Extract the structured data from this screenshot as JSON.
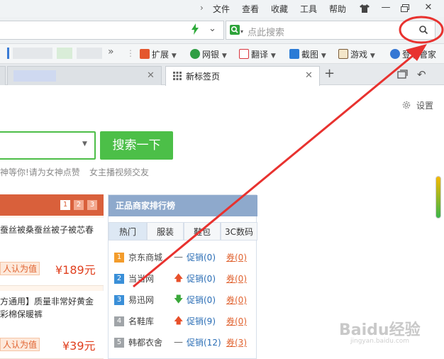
{
  "menu": {
    "items": [
      "文件",
      "查看",
      "收藏",
      "工具",
      "帮助"
    ]
  },
  "address_bar": {
    "search_placeholder": "点此搜索"
  },
  "bookmarks": {
    "items": [
      {
        "label": "扩展",
        "icon": "extension-icon",
        "color": "#e4572e"
      },
      {
        "label": "网银",
        "icon": "bank-shield-icon",
        "color": "#2f9e44"
      },
      {
        "label": "翻译",
        "icon": "translate-icon",
        "color": "#d9363e"
      },
      {
        "label": "截图",
        "icon": "scissors-icon",
        "color": "#2b7bd6"
      },
      {
        "label": "游戏",
        "icon": "gamepad-icon",
        "color": "#7a5c3a"
      },
      {
        "label": "登录管家",
        "icon": "login-manager-icon",
        "color": "#3577d4"
      }
    ]
  },
  "tabs": {
    "active_label": "新标签页"
  },
  "content": {
    "settings_label": "设置",
    "search_button": "搜索一下",
    "hot_links": [
      "神等你!请为女神点赞",
      "女主播视频交友"
    ]
  },
  "deals": {
    "pages": [
      "1",
      "2",
      "3"
    ],
    "items": [
      {
        "title_lines": [
          "蚕丝被桑蚕丝被子被芯春",
          ""
        ],
        "badge": "人认为值",
        "price": "¥189元"
      },
      {
        "title_lines": [
          "方通用】质量非常好黄金",
          "彩棉保暖裤"
        ],
        "badge": "人认为值",
        "price": "¥39元"
      }
    ]
  },
  "ranking": {
    "title": "正品商家排行榜",
    "tabs": [
      "热门",
      "服装",
      "鞋包",
      "3C数码"
    ],
    "rows": [
      {
        "rank": "1",
        "name": "京东商城",
        "trend": "flat",
        "promo": "促销(0)",
        "coupon": "券(0)",
        "color": "#f39c2b"
      },
      {
        "rank": "2",
        "name": "当当网",
        "trend": "up",
        "promo": "促销(0)",
        "coupon": "券(0)",
        "color": "#3a8fd8"
      },
      {
        "rank": "3",
        "name": "易迅网",
        "trend": "down",
        "promo": "促销(0)",
        "coupon": "券(0)",
        "color": "#3a8fd8"
      },
      {
        "rank": "4",
        "name": "名鞋库",
        "trend": "up",
        "promo": "促销(9)",
        "coupon": "券(0)",
        "color": "#a0a4a8"
      },
      {
        "rank": "5",
        "name": "韩都衣舍",
        "trend": "flat",
        "promo": "促销(12)",
        "coupon": "券(3)",
        "color": "#a0a4a8"
      }
    ]
  },
  "watermark": {
    "text": "Baidu经验",
    "sub": "jingyan.baidu.com"
  },
  "colors": {
    "accent_green": "#4cbf48",
    "deal_red": "#d9603b",
    "rank_blue": "#8ea9cc",
    "annotation_red": "#e8322f"
  }
}
